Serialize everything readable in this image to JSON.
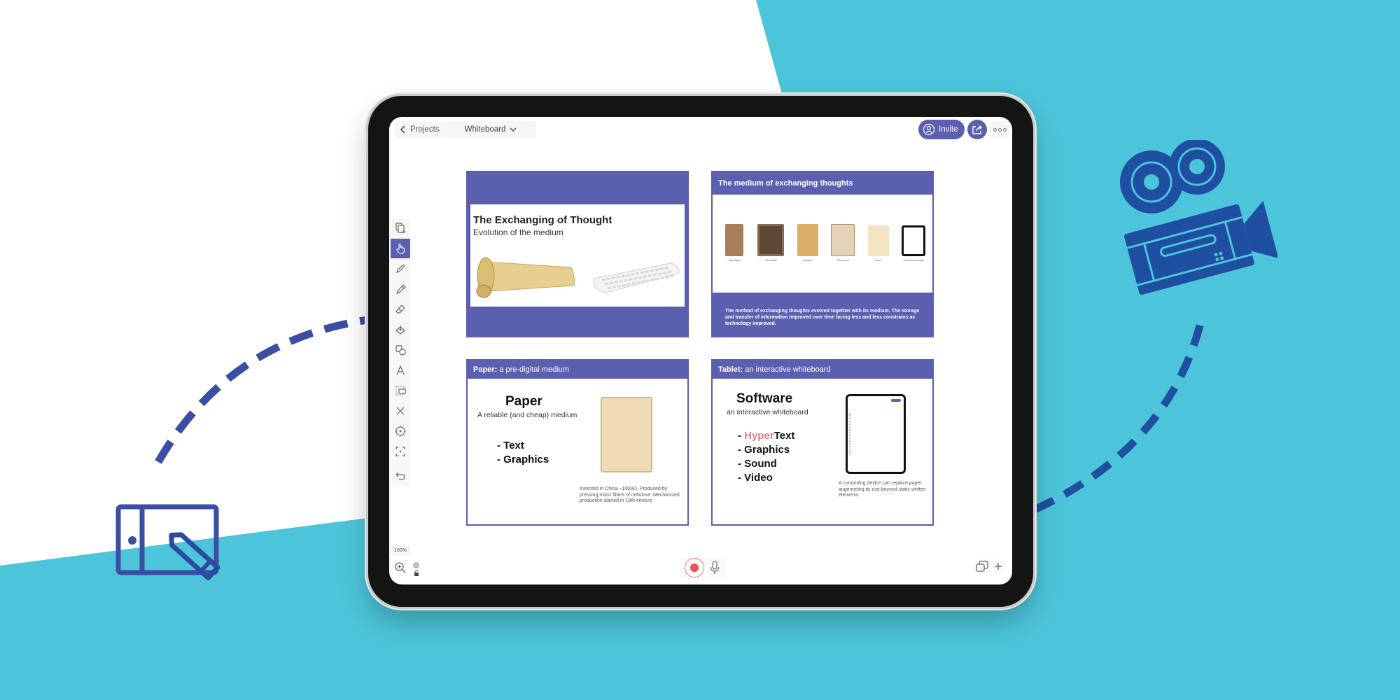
{
  "colors": {
    "background_teal": "#4cc4d9",
    "accent_indigo": "#5a5fb0",
    "illustration_blue": "#1f4fa0",
    "record_red": "#e8505b",
    "highlight_pink": "#e07f86"
  },
  "topbar": {
    "back_label": "Projects",
    "document_label": "Whiteboard",
    "invite_label": "Invite"
  },
  "toolbar": {
    "tools": [
      {
        "name": "add-page",
        "icon": "add-page-icon",
        "active": false
      },
      {
        "name": "hand",
        "icon": "hand-pointer-icon",
        "active": true
      },
      {
        "name": "pen",
        "icon": "pen-icon",
        "active": false
      },
      {
        "name": "highlighter",
        "icon": "highlighter-icon",
        "active": false
      },
      {
        "name": "eraser",
        "icon": "eraser-icon",
        "active": false
      },
      {
        "name": "fill",
        "icon": "paint-bucket-icon",
        "active": false
      },
      {
        "name": "shapes",
        "icon": "shapes-icon",
        "active": false
      },
      {
        "name": "text",
        "icon": "text-icon",
        "active": false
      },
      {
        "name": "select",
        "icon": "lasso-select-icon",
        "active": false
      },
      {
        "name": "delete",
        "icon": "close-icon",
        "active": false
      },
      {
        "name": "laser",
        "icon": "laser-pointer-icon",
        "active": false
      },
      {
        "name": "frame",
        "icon": "frame-icon",
        "active": false
      },
      {
        "name": "undo",
        "icon": "undo-icon",
        "active": false
      }
    ]
  },
  "bottombar": {
    "zoom_level": "100%"
  },
  "slides": [
    {
      "title": "The Exchanging of Thought",
      "subtitle": "Evolution of the medium"
    },
    {
      "header": "The medium of exchanging thoughts",
      "media_items": [
        {
          "caption": "Clay tablet"
        },
        {
          "caption": "Wax tablet"
        },
        {
          "caption": "Papyrus"
        },
        {
          "caption": "Parchment"
        },
        {
          "caption": "Paper"
        },
        {
          "caption": "Touchscreen tablet"
        }
      ],
      "footer": "The method of exchanging thoughts evolved together with its medium. The storage and transfer of information improved over time facing less and less constrains as technology improved."
    },
    {
      "header_bold": "Paper:",
      "header_rest": " a pre-digital medium",
      "title": "Paper",
      "subtitle": "A reliable (and cheap) medium",
      "bullets": [
        "- Text",
        "- Graphics"
      ],
      "note": "Invented in China ~100AD. Produced by pressing moist fibers of cellulose. Mechanized production started in 19th century"
    },
    {
      "header_bold": "Tablet:",
      "header_rest": " an interactive whiteboard",
      "title": "Software",
      "subtitle": "an interactive whiteboard",
      "bullet_first_highlight": "Hyper",
      "bullet_first_rest": "Text",
      "bullets": [
        "- Graphics",
        "- Sound",
        "- Video"
      ],
      "note": "A computing device can replace paper augmenting its use beyond static written elements"
    }
  ]
}
